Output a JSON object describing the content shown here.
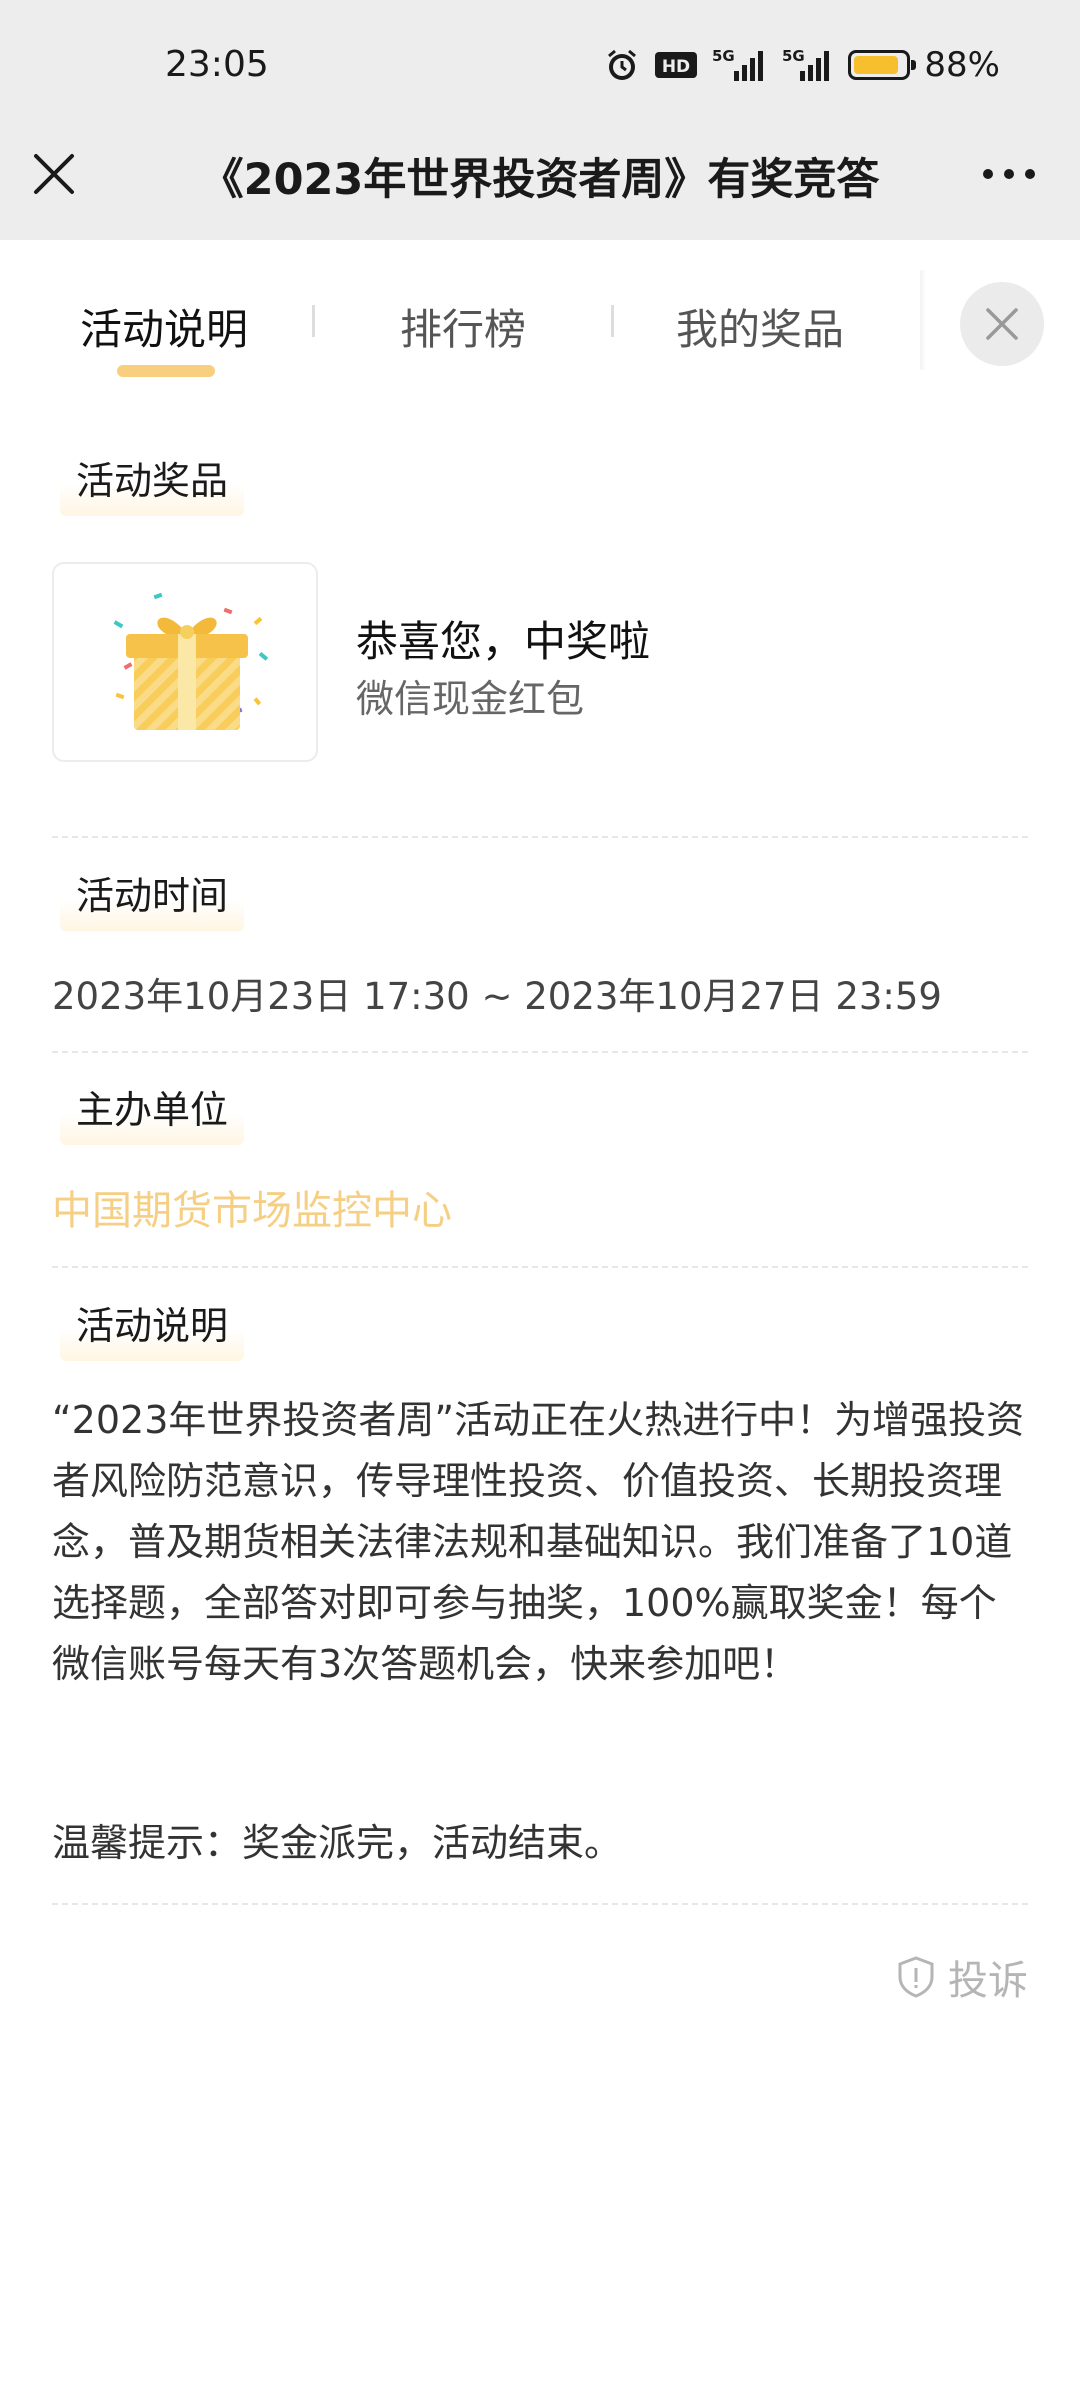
{
  "status_bar": {
    "time": "23:05",
    "battery_level": 88,
    "battery_text": "88%",
    "icons": [
      "alarm-icon",
      "hd-icon",
      "signal-5g-icon",
      "signal-5g-icon",
      "battery-icon"
    ],
    "hd_label": "HD",
    "net1_label": "5G",
    "net2_label": "5G"
  },
  "nav": {
    "title": "《2023年世界投资者周》有奖竞答",
    "close_icon": "close-icon",
    "more_icon": "more-icon"
  },
  "tabs": [
    {
      "label": "活动说明",
      "active": true
    },
    {
      "label": "排行榜",
      "active": false
    },
    {
      "label": "我的奖品",
      "active": false
    }
  ],
  "sections": {
    "prize": {
      "label": "活动奖品",
      "title": "恭喜您，中奖啦",
      "subtitle": "微信现金红包",
      "icon": "gift-icon"
    },
    "time": {
      "label": "活动时间",
      "value": "2023年10月23日  17:30  ~  2023年10月27日  23:59"
    },
    "organizer": {
      "label": "主办单位",
      "value": "中国期货市场监控中心"
    },
    "description": {
      "label": "活动说明",
      "body": "“2023年世界投资者周”活动正在火热进行中！为增强投资者风险防范意识，传导理性投资、价值投资、长期投资理念，普及期货相关法律法规和基础知识。我们准备了10道选择题，全部答对即可参与抽奖，100%赢取奖金！每个微信账号每天有3次答题机会，快来参加吧！",
      "tip": "温馨提示：奖金派完，活动结束。"
    }
  },
  "report": {
    "label": "投诉",
    "icon": "shield-alert-icon"
  },
  "colors": {
    "accent": "#f7cf7e",
    "organizer": "#f5cf84",
    "battery": "#f7bf2e"
  }
}
